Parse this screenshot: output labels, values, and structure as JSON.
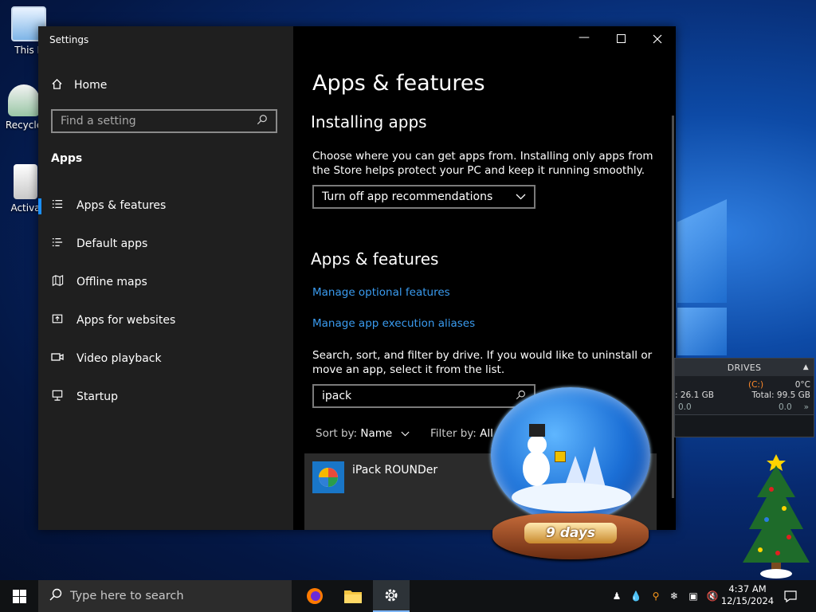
{
  "desktop": {
    "icons": [
      {
        "label": "This P",
        "name": "this-pc"
      },
      {
        "label": "Recycle",
        "name": "recycle-bin"
      },
      {
        "label": "Activa",
        "name": "activate"
      }
    ]
  },
  "settings": {
    "window_title": "Settings",
    "sidebar": {
      "home": "Home",
      "search_placeholder": "Find a setting",
      "section": "Apps",
      "items": [
        {
          "label": "Apps & features",
          "icon": "list-icon",
          "active": true
        },
        {
          "label": "Default apps",
          "icon": "default-apps-icon"
        },
        {
          "label": "Offline maps",
          "icon": "map-icon"
        },
        {
          "label": "Apps for websites",
          "icon": "link-box-icon"
        },
        {
          "label": "Video playback",
          "icon": "video-icon"
        },
        {
          "label": "Startup",
          "icon": "startup-icon"
        }
      ]
    },
    "main": {
      "page_title": "Apps & features",
      "installing_heading": "Installing apps",
      "installing_text": "Choose where you can get apps from. Installing only apps from the Store helps protect your PC and keep it running smoothly.",
      "install_dropdown": "Turn off app recommendations",
      "features_heading": "Apps & features",
      "link_optional": "Manage optional features",
      "link_aliases": "Manage app execution aliases",
      "search_text": "Search, sort, and filter by drive. If you would like to uninstall or move an app, select it from the list.",
      "app_search_value": "ipack",
      "sort_label": "Sort by:",
      "sort_value": "Name",
      "filter_label": "Filter by:",
      "filter_value": "All d",
      "apps": [
        {
          "name": "iPack ROUNDer"
        }
      ]
    }
  },
  "snowglobe": {
    "label": "9 days"
  },
  "drives_gadget": {
    "title": "DRIVES",
    "drive": "(C:)",
    "temp": "0°C",
    "used": ": 26.1 GB",
    "total": "Total: 99.5 GB",
    "read": "0.0",
    "write": "0.0"
  },
  "taskbar": {
    "search_placeholder": "Type here to search",
    "time": "4:37 AM",
    "date": "12/15/2024"
  },
  "colors": {
    "accent": "#1a8fff",
    "link": "#3a9bef",
    "sidebar_bg": "#1f1f1f",
    "main_bg": "#000000"
  }
}
